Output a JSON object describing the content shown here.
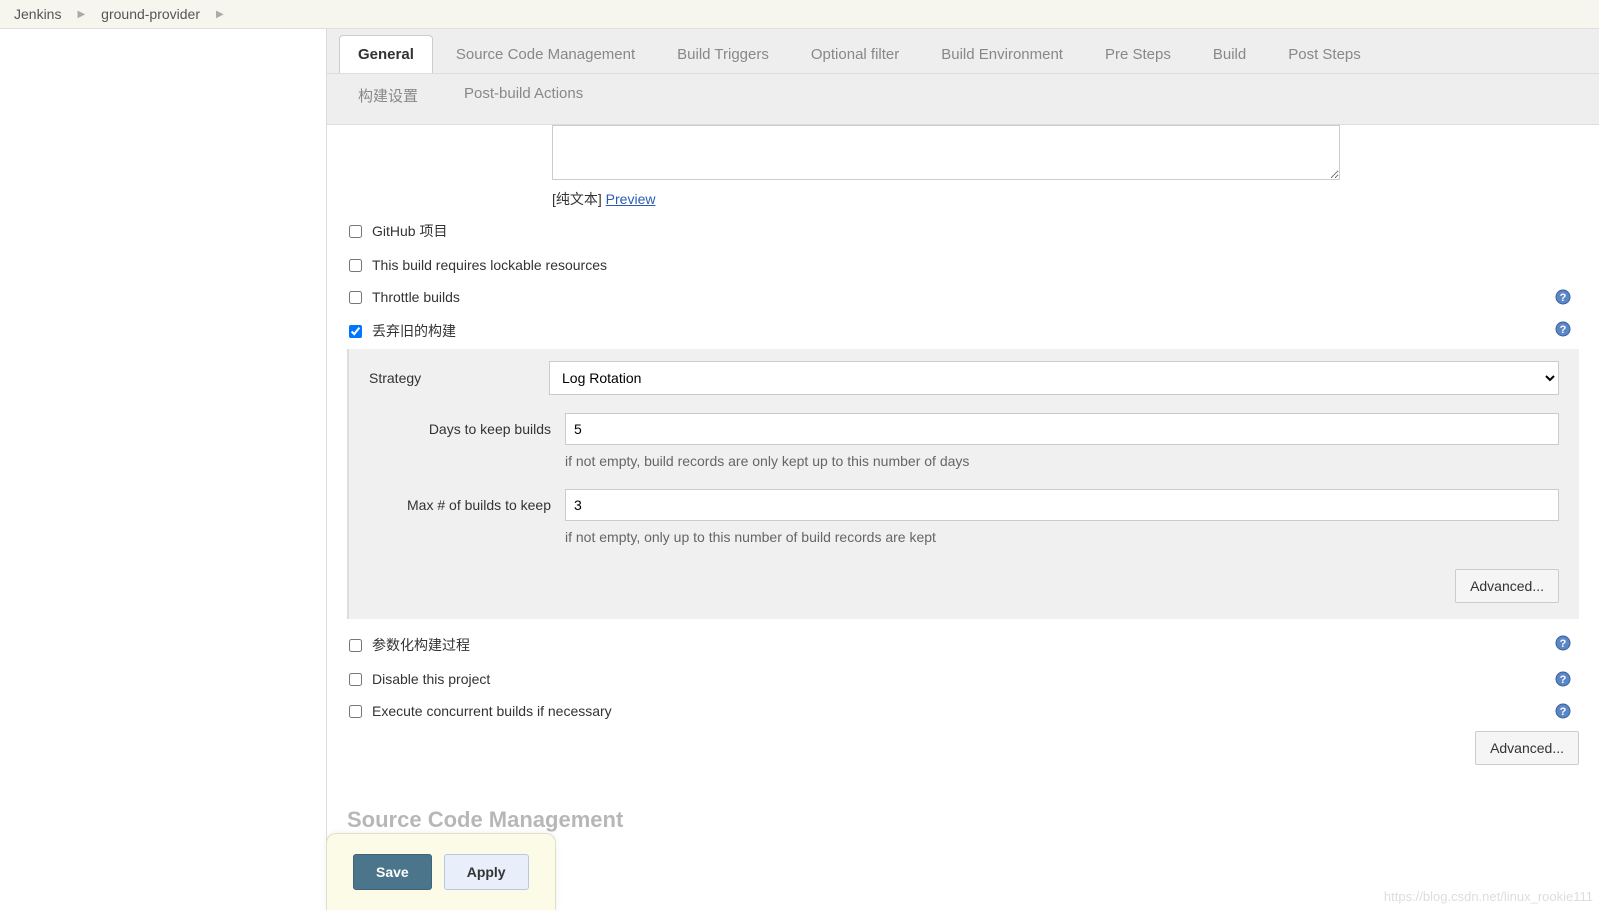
{
  "breadcrumb": {
    "items": [
      "Jenkins",
      "ground-provider"
    ]
  },
  "tabs": {
    "row1": [
      "General",
      "Source Code Management",
      "Build Triggers",
      "Optional filter",
      "Build Environment",
      "Pre Steps",
      "Build",
      "Post Steps"
    ],
    "row2": [
      "构建设置",
      "Post-build Actions"
    ],
    "active": "General"
  },
  "description": {
    "value": "",
    "hint_prefix": "[纯文本] ",
    "preview_link": "Preview"
  },
  "options": {
    "github_project": {
      "label": "GitHub 项目",
      "checked": false
    },
    "lockable": {
      "label": "This build requires lockable resources",
      "checked": false
    },
    "throttle": {
      "label": "Throttle builds",
      "checked": false,
      "help": true
    },
    "discard_old": {
      "label": "丢弃旧的构建",
      "checked": true,
      "help": true
    },
    "parameterized": {
      "label": "参数化构建过程",
      "checked": false,
      "help": true
    },
    "disable": {
      "label": "Disable this project",
      "checked": false,
      "help": true
    },
    "concurrent": {
      "label": "Execute concurrent builds if necessary",
      "checked": false,
      "help": true
    }
  },
  "discard": {
    "strategy_label": "Strategy",
    "strategy_value": "Log Rotation",
    "days_label": "Days to keep builds",
    "days_value": "5",
    "days_hint": "if not empty, build records are only kept up to this number of days",
    "max_label": "Max # of builds to keep",
    "max_value": "3",
    "max_hint": "if not empty, only up to this number of build records are kept",
    "advanced_btn": "Advanced..."
  },
  "advanced_btn2": "Advanced...",
  "section_scm": "Source Code Management",
  "actions": {
    "save": "Save",
    "apply": "Apply"
  },
  "watermark": "https://blog.csdn.net/linux_rookie111"
}
